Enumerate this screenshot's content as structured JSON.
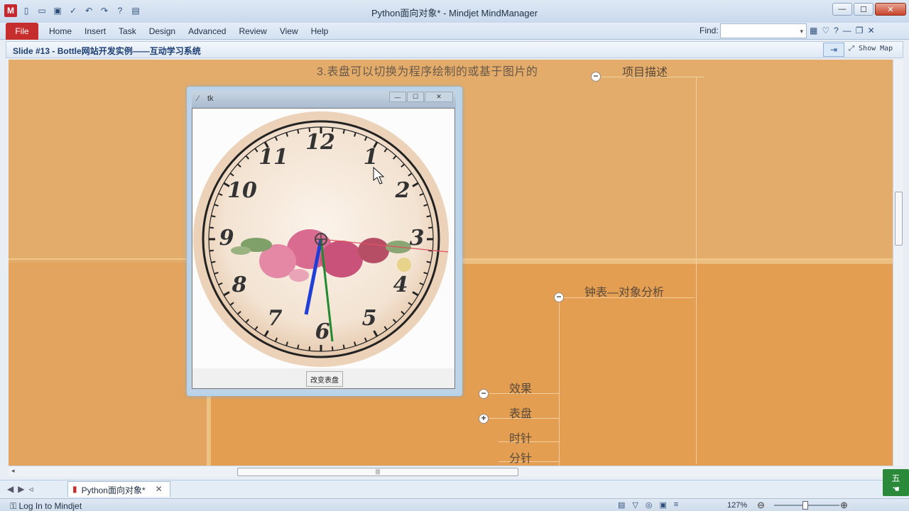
{
  "window": {
    "title": "Python面向对象* - Mindjet MindManager"
  },
  "ribbon": {
    "file": "File",
    "tabs": [
      "Home",
      "Insert",
      "Task",
      "Design",
      "Advanced",
      "Review",
      "View",
      "Help"
    ],
    "find_label": "Find:"
  },
  "slide": {
    "title": "Slide #13 - Bottle网站开发实例——互动学习系统",
    "show_map": "Show Map"
  },
  "map": {
    "description_line": "3.表盘可以切换为程序绘制的或基于图片的",
    "topic_project": "项目描述",
    "topic_clock": "钟表—对象分析",
    "sub_topics": [
      "效果",
      "表盘",
      "时针",
      "分针"
    ],
    "collapse_symbol": "−",
    "expand_symbol": "+"
  },
  "tk_window": {
    "title": "tk",
    "button": "改变表盘",
    "numerals": [
      "12",
      "1",
      "2",
      "3",
      "4",
      "5",
      "6",
      "7",
      "8",
      "9",
      "10",
      "11"
    ]
  },
  "doc_tab": {
    "label": "Python面向对象*"
  },
  "status": {
    "login": "Log In to Mindjet",
    "zoom": "127%"
  },
  "ime": {
    "label": "五"
  }
}
